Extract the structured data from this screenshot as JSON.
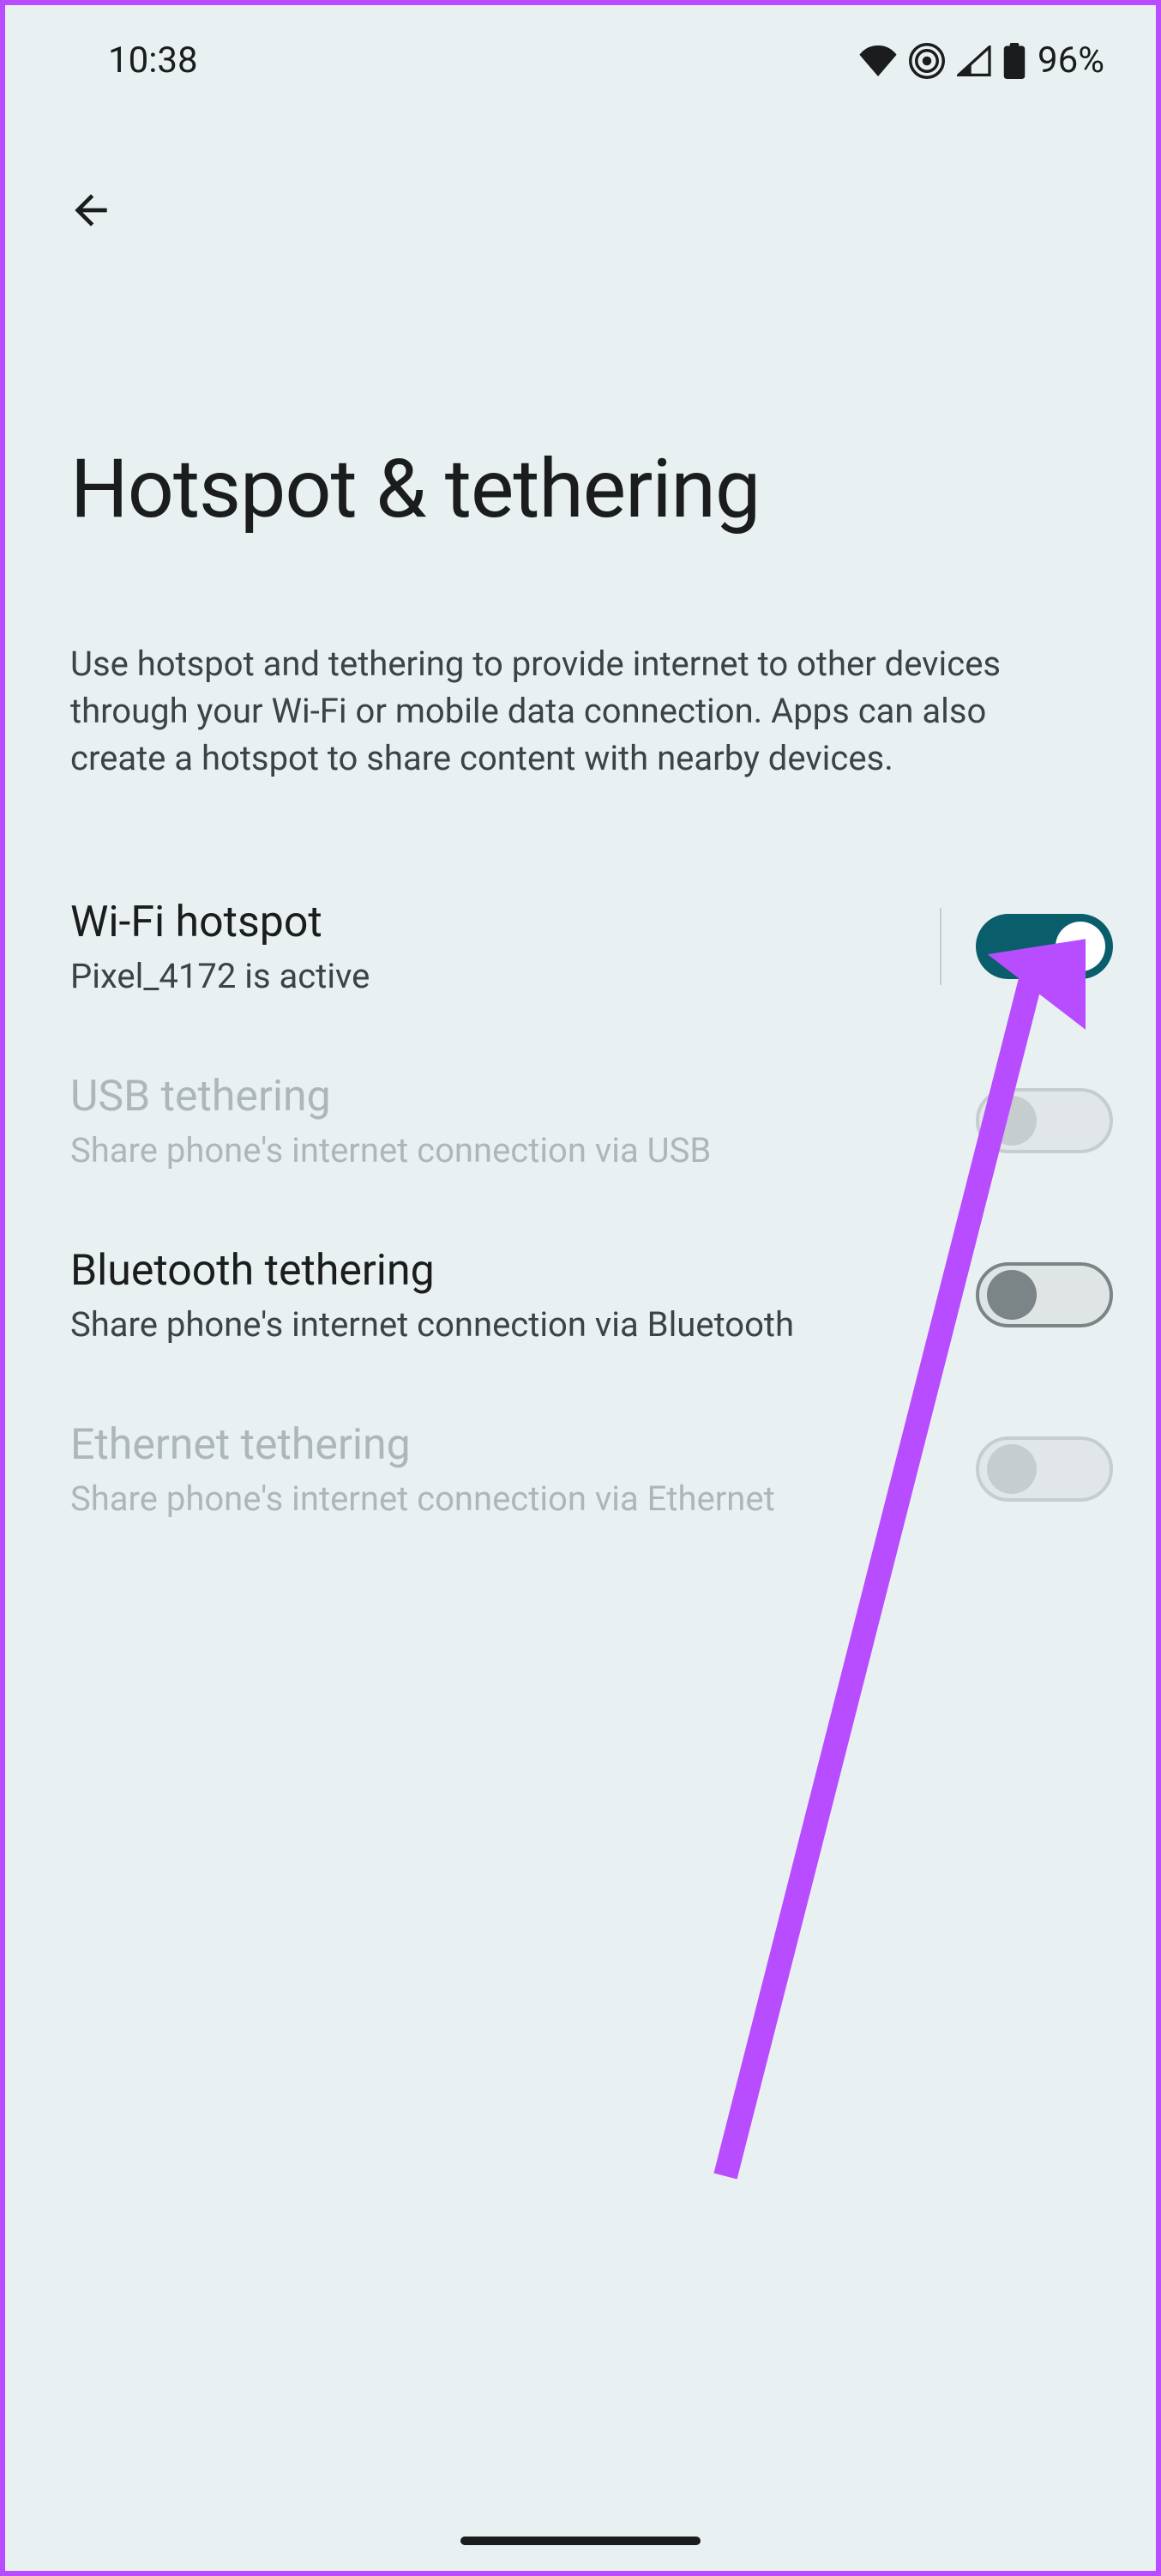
{
  "status": {
    "time": "10:38",
    "battery_pct": "96%"
  },
  "page": {
    "title": "Hotspot & tethering",
    "description": "Use hotspot and tethering to provide internet to other devices through your Wi-Fi or mobile data connection. Apps can also create a hotspot to share content with nearby devices."
  },
  "settings": {
    "wifi_hotspot": {
      "title": "Wi-Fi hotspot",
      "sub": "Pixel_4172 is active",
      "on": true,
      "disabled": false
    },
    "usb_tethering": {
      "title": "USB tethering",
      "sub": "Share phone's internet connection via USB",
      "on": false,
      "disabled": true
    },
    "bluetooth_tethering": {
      "title": "Bluetooth tethering",
      "sub": "Share phone's internet connection via Bluetooth",
      "on": false,
      "disabled": false
    },
    "ethernet_tethering": {
      "title": "Ethernet tethering",
      "sub": "Share phone's internet connection via Ethernet",
      "on": false,
      "disabled": true
    }
  },
  "annotation": {
    "arrow_color": "#b84cff"
  }
}
